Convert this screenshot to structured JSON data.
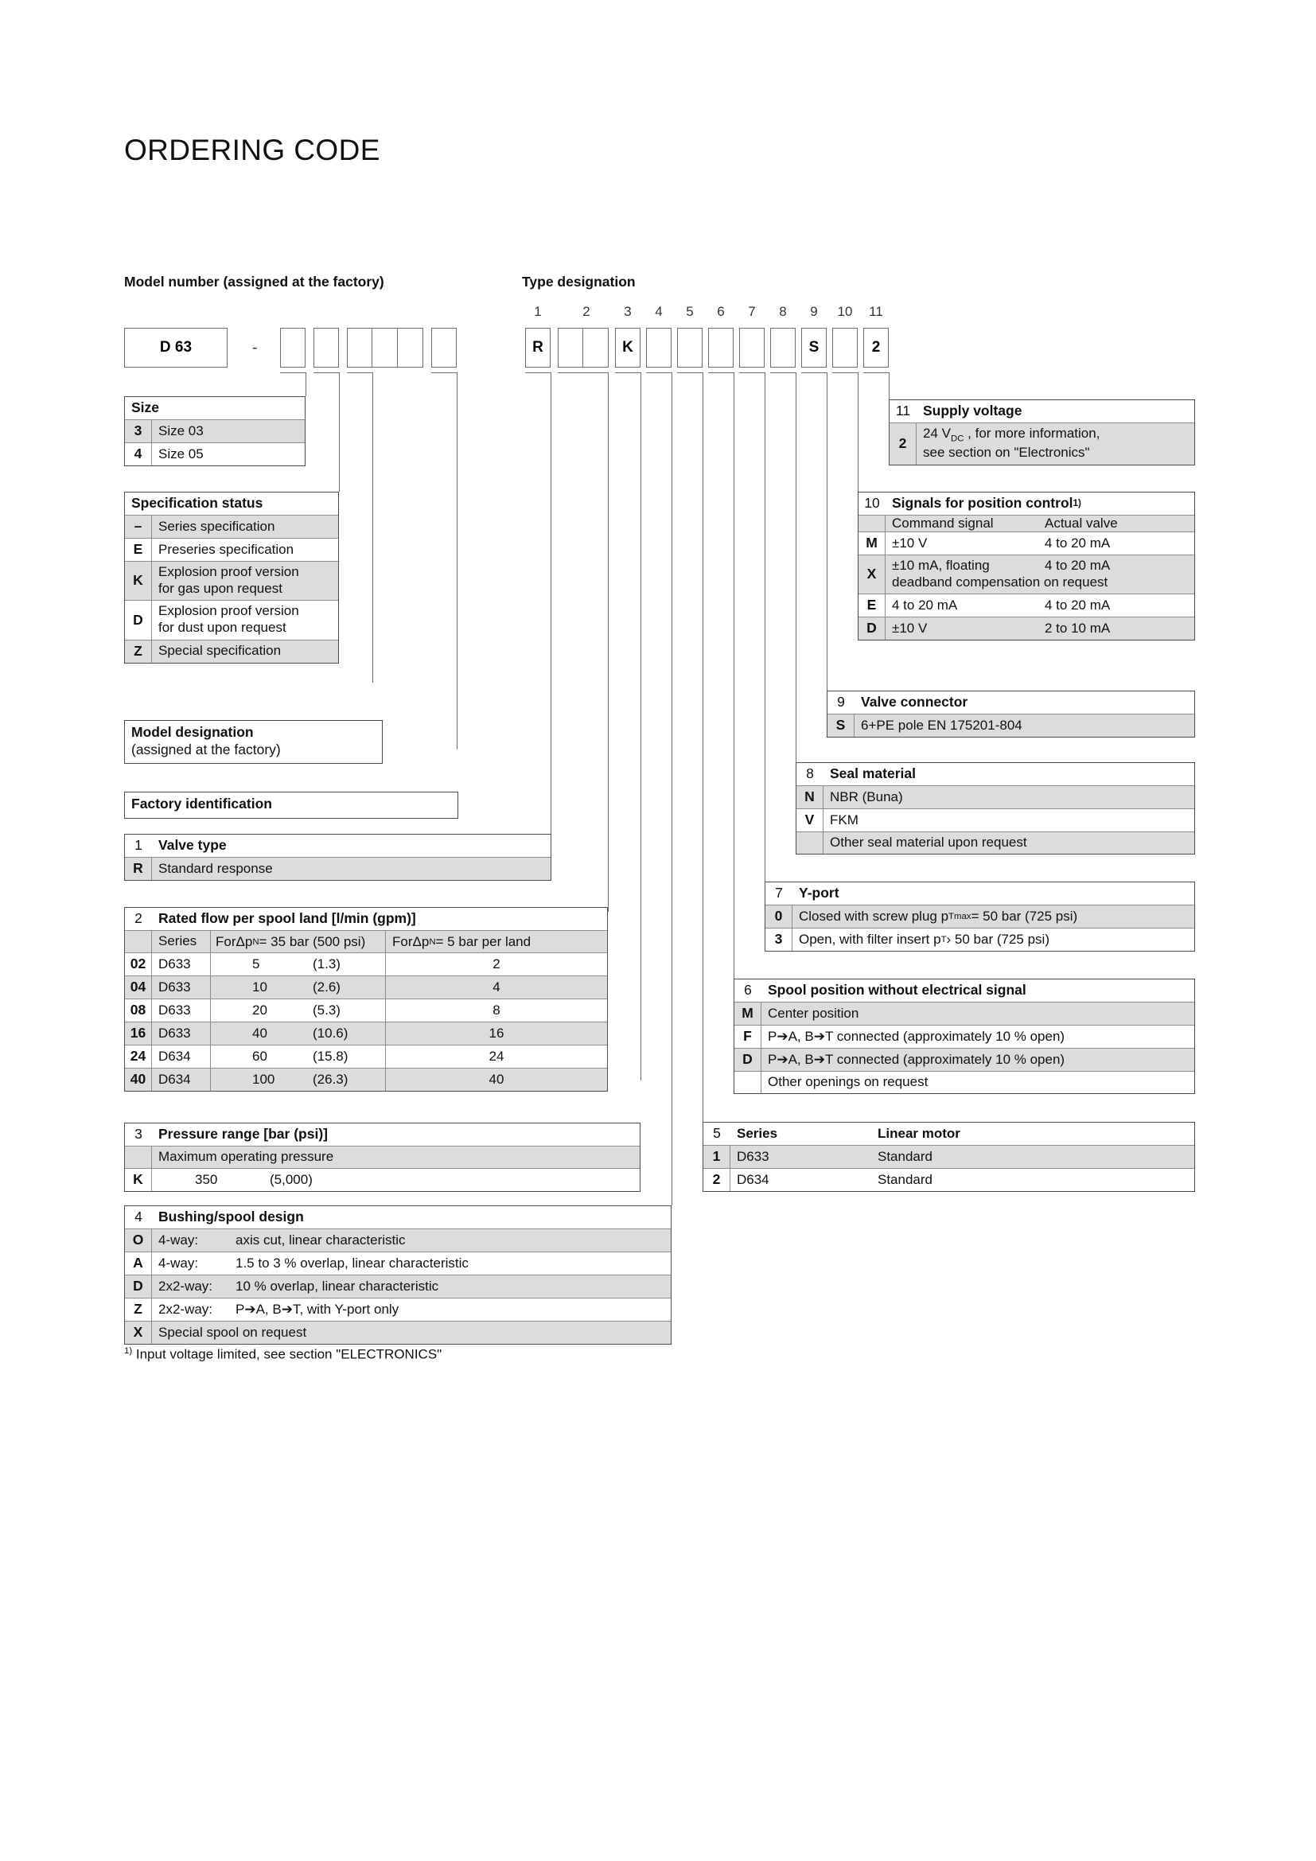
{
  "page": {
    "title": "ORDERING CODE"
  },
  "model_number": {
    "caption": "Model number (assigned at the factory)",
    "prefix_box": "D 63",
    "separator": "-"
  },
  "type_designation": {
    "caption": "Type designation",
    "positions": [
      "1",
      "2",
      "3",
      "4",
      "5",
      "6",
      "7",
      "8",
      "9",
      "10",
      "11"
    ],
    "values": {
      "p1": "R",
      "p3": "K",
      "p9": "S",
      "p11": "2"
    }
  },
  "size_table": {
    "header": "Size",
    "rows": [
      {
        "key": "3",
        "value": "Size 03"
      },
      {
        "key": "4",
        "value": "Size 05"
      }
    ]
  },
  "spec_status_table": {
    "header": "Specification status",
    "rows": [
      {
        "key": "–",
        "value": "Series specification"
      },
      {
        "key": "E",
        "value": "Preseries specification"
      },
      {
        "key": "K",
        "line1": "Explosion proof version",
        "line2": "for gas upon request"
      },
      {
        "key": "D",
        "line1": "Explosion proof version",
        "line2": "for dust upon request"
      },
      {
        "key": "Z",
        "value": "Special specification"
      }
    ]
  },
  "model_designation_box": {
    "line1": "Model designation",
    "line2": "(assigned at the factory)"
  },
  "factory_identification_box": {
    "line1": "Factory identification"
  },
  "section1": {
    "number": "1",
    "title": "Valve type",
    "rows": [
      {
        "key": "R",
        "value": "Standard response"
      }
    ]
  },
  "section2": {
    "number": "2",
    "title": "Rated flow per spool land [l/min (gpm)]",
    "col_series": "Series",
    "col_a_pre": "For",
    "col_a_sym": "Δp",
    "col_a_sub": "N",
    "col_a_post": "= 35 bar (500 psi)",
    "col_b_pre": "For ",
    "col_b_sym": "Δp",
    "col_b_sub": "N",
    "col_b_post": "= 5 bar per land",
    "rows": [
      {
        "key": "02",
        "series": "D633",
        "lmin": "5",
        "gpm": "(1.3)",
        "perland": "2"
      },
      {
        "key": "04",
        "series": "D633",
        "lmin": "10",
        "gpm": "(2.6)",
        "perland": "4"
      },
      {
        "key": "08",
        "series": "D633",
        "lmin": "20",
        "gpm": "(5.3)",
        "perland": "8"
      },
      {
        "key": "16",
        "series": "D633",
        "lmin": "40",
        "gpm": "(10.6)",
        "perland": "16"
      },
      {
        "key": "24",
        "series": "D634",
        "lmin": "60",
        "gpm": "(15.8)",
        "perland": "24"
      },
      {
        "key": "40",
        "series": "D634",
        "lmin": "100",
        "gpm": "(26.3)",
        "perland": "40"
      }
    ]
  },
  "section3": {
    "number": "3",
    "title": "Pressure range [bar (psi)]",
    "subhead": "Maximum operating pressure",
    "rows": [
      {
        "key": "K",
        "bar": "350",
        "psi": "(5,000)"
      }
    ]
  },
  "section4": {
    "number": "4",
    "title": "Bushing/spool design",
    "rows": [
      {
        "key": "O",
        "way": "4-way:",
        "desc": "axis cut, linear characteristic"
      },
      {
        "key": "A",
        "way": "4-way:",
        "desc": "1.5 to 3 % overlap, linear characteristic"
      },
      {
        "key": "D",
        "way": "2x2-way:",
        "desc": "10 % overlap, linear characteristic"
      },
      {
        "key": "Z",
        "way": "2x2-way:",
        "desc": "P➔A, B➔T, with Y-port only"
      },
      {
        "key": "X",
        "way": "",
        "desc": "Special spool on request"
      }
    ]
  },
  "section5": {
    "number": "5",
    "title": "Series",
    "col_motor": "Linear motor",
    "rows": [
      {
        "key": "1",
        "series": "D633",
        "motor": "Standard"
      },
      {
        "key": "2",
        "series": "D634",
        "motor": "Standard"
      }
    ]
  },
  "section6": {
    "number": "6",
    "title": "Spool position without electrical signal",
    "rows": [
      {
        "key": "M",
        "value": "Center position"
      },
      {
        "key": "F",
        "value": "P➔A, B➔T connected (approximately 10 % open)"
      },
      {
        "key": "D",
        "value": "P➔A, B➔T connected (approximately 10 % open)"
      },
      {
        "key": "",
        "value": "Other openings on request"
      }
    ]
  },
  "section7": {
    "number": "7",
    "title": "Y-port",
    "rows": [
      {
        "key": "0",
        "pre": "Closed with screw plug p",
        "sub": "Tmax",
        "post": " = 50 bar (725 psi)"
      },
      {
        "key": "3",
        "pre": "Open, with filter insert p",
        "sub": "T",
        "post": " › 50 bar (725 psi)"
      }
    ]
  },
  "section8": {
    "number": "8",
    "title": "Seal material",
    "rows": [
      {
        "key": "N",
        "value": "NBR (Buna)"
      },
      {
        "key": "V",
        "value": "FKM"
      },
      {
        "key": "",
        "value": "Other seal material upon request"
      }
    ]
  },
  "section9": {
    "number": "9",
    "title": "Valve connector",
    "rows": [
      {
        "key": "S",
        "value": "6+PE pole EN 175201-804"
      }
    ]
  },
  "section10": {
    "number": "10",
    "title_main": "Signals for position control",
    "title_sup": "1)",
    "col_command": "Command signal",
    "col_actual": "Actual valve",
    "rows": [
      {
        "key": "M",
        "command": "±10 V",
        "actual": "4 to 20 mA",
        "note": ""
      },
      {
        "key": "X",
        "command": "±10 mA, floating",
        "actual": "4 to 20 mA",
        "note": "deadband compensation on request"
      },
      {
        "key": "E",
        "command": "4 to 20 mA",
        "actual": "4 to 20 mA",
        "note": ""
      },
      {
        "key": "D",
        "command": "±10 V",
        "actual": "2 to 10 mA",
        "note": ""
      }
    ]
  },
  "section11": {
    "number": "11",
    "title": "Supply voltage",
    "rows": [
      {
        "key": "2",
        "pre": "24 V",
        "sub": "DC",
        "post": " , for more information,",
        "line2": "see section on \"Electronics\""
      }
    ]
  },
  "footnote": {
    "marker": "1)",
    "text": "Input voltage limited, see section \"ELECTRONICS\""
  },
  "colors": {
    "shade": "#dcdcdc",
    "border": "#4d4d4d",
    "line": "#6c6c6c"
  }
}
